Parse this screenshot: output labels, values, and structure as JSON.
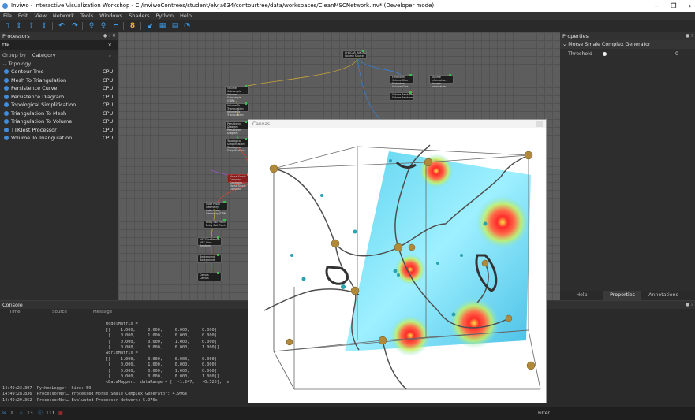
{
  "window": {
    "title": "Inviwo - Interactive Visualization Workshop - C:/inviwoContrees/student/elvja634/contourtree/data/workspaces/CleanMSCNetwork.inv* (Developer mode)",
    "minimize": "–",
    "maximize": "❐",
    "close": "›"
  },
  "menu": [
    "File",
    "Edit",
    "View",
    "Network",
    "Tools",
    "Windows",
    "Shaders",
    "Python",
    "Help"
  ],
  "toolbar_icons": [
    "new-file-icon",
    "open-icon",
    "save-icon",
    "save-as-icon",
    "undo-icon",
    "redo-icon",
    "select-icon",
    "link-icon",
    "pin-icon",
    "info-icon",
    "lock-icon",
    "image-icon",
    "layout-icon",
    "timer-icon"
  ],
  "processors": {
    "title": "Processors",
    "search_value": "ttk",
    "clear": "×",
    "group_label": "Group by",
    "group_value": "Category",
    "topology": "Topology",
    "items": [
      {
        "name": "Contour Tree",
        "tag": "CPU"
      },
      {
        "name": "Mesh To Triangulation",
        "tag": "CPU"
      },
      {
        "name": "Persistence Curve",
        "tag": "CPU"
      },
      {
        "name": "Persistence Diagram",
        "tag": "CPU"
      },
      {
        "name": "Topological Simplification",
        "tag": "CPU"
      },
      {
        "name": "Triangulation To Mesh",
        "tag": "CPU"
      },
      {
        "name": "Triangulation To Volume",
        "tag": "CPU"
      },
      {
        "name": "TTKTest Processor",
        "tag": "CPU"
      },
      {
        "name": "Volume To Triangulation",
        "tag": "CPU"
      }
    ]
  },
  "network_nodes": [
    {
      "label": "CHGCAR_AMGRD",
      "sub": "Volume Source"
    },
    {
      "label": "Volume Subsample",
      "sub": "Volume Subsample (DBN)"
    },
    {
      "label": "Volume To Triangulation",
      "sub": "Volume To Triangulation"
    },
    {
      "label": "Persistence Diagram",
      "sub": "Persistence Diagram"
    },
    {
      "label": "Topological Simplification",
      "sub": "Topological Simplification"
    },
    {
      "label": "Morse Smale Complex Generator",
      "sub": "Morse Smale Complex"
    },
    {
      "label": "Cube Proxy Geometry",
      "sub": "Cube Proxy Geometry (DBN)"
    },
    {
      "label": "Entry Exit Points",
      "sub": "Entry Exit Points"
    },
    {
      "label": "MSCSliceRender",
      "sub": "MSC Slice Renderer"
    },
    {
      "label": "Background",
      "sub": "Background"
    },
    {
      "label": "Canvas",
      "sub": "Canvas"
    },
    {
      "label": "Embedded Volume Slice",
      "sub": "Embedded Volume Slice"
    },
    {
      "label": "Volume Information",
      "sub": "Volume Information"
    },
    {
      "label": "Sphere Renderer",
      "sub": "Sphere Renderer"
    }
  ],
  "properties": {
    "title": "Properties",
    "section": "Morse Smale Complex Generator",
    "threshold_label": "Threshold",
    "threshold_value": "0",
    "tabs": [
      "Help",
      "Properties",
      "Annotations"
    ]
  },
  "console": {
    "title": "Console",
    "cols": [
      "Time",
      "Source",
      "Message"
    ],
    "lines": [
      "                                          modelMatrix =",
      "                                          [[    1.000,     0.000,     0.000,     0.000]",
      "                                           [    0.000,     1.000,     0.000,     0.000]",
      "                                           [    0.000,     0.000,     1.000,     0.000]",
      "                                           [    0.000,     0.000,     0.000,     1.000]]",
      "                                          worldMatrix =",
      "                                          [[    1.000,     0.000,     0.000,     0.000]",
      "                                           [    0.000,     1.000,     0.000,     0.000]",
      "                                           [    0.000,     0.000,     1.000,     0.000]",
      "                                           [    0.000,     0.000,     0.000,     1.000]]",
      "                                          <DataMapper:  dataRange = [  -1.247,   -0.525],  v",
      "14:49:23.397  PythonLogger  Size: 59",
      "14:49:28.836  ProcessorNet… Processed Morse Smale Complex Generator: 4.996s",
      "14:49:29.362  ProcessorNet… Evaluated Processor Network: 5.976s"
    ]
  },
  "status": {
    "errors": "1",
    "warnings": "13",
    "info": "111",
    "filter_label": "Filter"
  },
  "canvas": {
    "title": "Canvas"
  },
  "colors": {
    "accent": "#3d9be9",
    "node_ok": "#3dbd52",
    "node_error": "#8a1d1d"
  }
}
